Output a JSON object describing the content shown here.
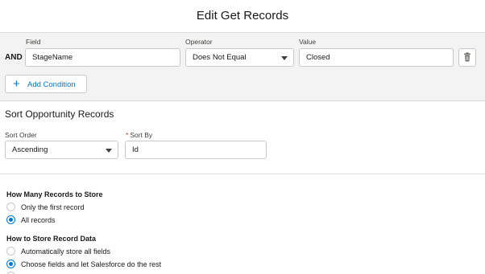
{
  "header": {
    "title": "Edit Get Records"
  },
  "filter": {
    "logic": "AND",
    "field_label": "Field",
    "operator_label": "Operator",
    "value_label": "Value",
    "field_value": "StageName",
    "operator_value": "Does Not Equal",
    "value_value": "Closed",
    "add_condition_label": "Add Condition",
    "icons": {
      "delete": "trash-icon",
      "add": "plus-icon",
      "dropdown": "chevron-down-icon"
    }
  },
  "sort": {
    "title": "Sort Opportunity Records",
    "order_label": "Sort Order",
    "order_value": "Ascending",
    "by_required_marker": "*",
    "by_label": "Sort By",
    "by_value": "Id"
  },
  "store": {
    "how_many_title": "How Many Records to Store",
    "how_many_options": [
      {
        "label": "Only the first record",
        "selected": false
      },
      {
        "label": "All records",
        "selected": true
      }
    ],
    "how_store_title": "How to Store Record Data",
    "how_store_options": [
      {
        "label": "Automatically store all fields",
        "selected": false
      },
      {
        "label": "Choose fields and let Salesforce do the rest",
        "selected": true
      }
    ]
  },
  "colors": {
    "accent": "#0176d3",
    "border": "#c9c9c9",
    "section_bg": "#f3f3f3"
  }
}
